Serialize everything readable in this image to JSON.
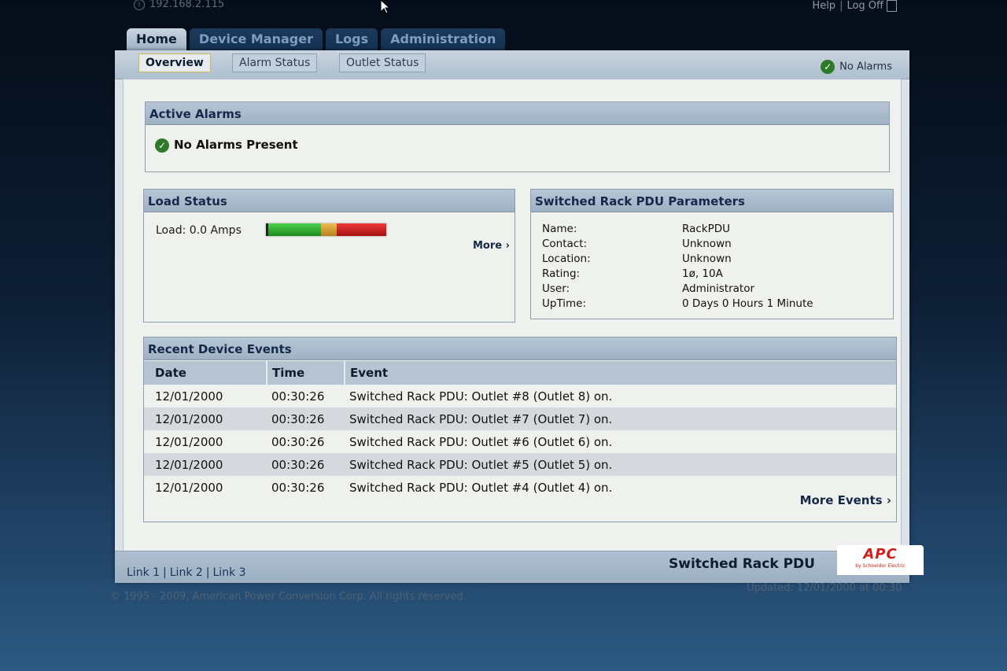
{
  "topbar": {
    "ip": "192.168.2.115",
    "help": "Help",
    "separator": "|",
    "logoff": "Log Off"
  },
  "main_tabs": [
    {
      "label": "Home",
      "active": true
    },
    {
      "label": "Device Manager",
      "active": false
    },
    {
      "label": "Logs",
      "active": false
    },
    {
      "label": "Administration",
      "active": false
    }
  ],
  "sub_tabs": [
    {
      "label": "Overview",
      "active": true
    },
    {
      "label": "Alarm Status",
      "active": false
    },
    {
      "label": "Outlet Status",
      "active": false
    }
  ],
  "status_top": "No Alarms",
  "active_alarms": {
    "title": "Active Alarms",
    "message": "No Alarms Present"
  },
  "load_status": {
    "title": "Load Status",
    "label": "Load: 0.0 Amps",
    "load_amps": 0.0,
    "more": "More"
  },
  "pdu_params": {
    "title": "Switched Rack PDU Parameters",
    "rows": [
      {
        "label": "Name:",
        "value": "RackPDU"
      },
      {
        "label": "Contact:",
        "value": "Unknown"
      },
      {
        "label": "Location:",
        "value": "Unknown"
      },
      {
        "label": "Rating:",
        "value": "1ø, 10A"
      },
      {
        "label": "User:",
        "value": "Administrator"
      },
      {
        "label": "UpTime:",
        "value": "0 Days 0 Hours 1 Minute"
      }
    ]
  },
  "recent_events": {
    "title": "Recent Device Events",
    "columns": [
      "Date",
      "Time",
      "Event"
    ],
    "rows": [
      [
        "12/01/2000",
        "00:30:26",
        "Switched Rack PDU: Outlet #8 (Outlet 8) on."
      ],
      [
        "12/01/2000",
        "00:30:26",
        "Switched Rack PDU: Outlet #7 (Outlet 7) on."
      ],
      [
        "12/01/2000",
        "00:30:26",
        "Switched Rack PDU: Outlet #6 (Outlet 6) on."
      ],
      [
        "12/01/2000",
        "00:30:26",
        "Switched Rack PDU: Outlet #5 (Outlet 5) on."
      ],
      [
        "12/01/2000",
        "00:30:26",
        "Switched Rack PDU: Outlet #4 (Outlet 4) on."
      ]
    ],
    "more": "More Events"
  },
  "footer": {
    "links": [
      "Link 1",
      "Link 2",
      "Link 3"
    ],
    "product": "Switched Rack PDU",
    "logo_text": "APC",
    "logo_sub": "by Schneider Electric",
    "copyright": "© 1995 - 2009, American Power Conversion Corp. All rights reserved.",
    "updated": "Updated: 12/01/2000 at 00:30"
  },
  "colors": {
    "ok_green": "#2f7a28",
    "bar_green": "#2ea82e",
    "bar_orange": "#d49a2a",
    "bar_red": "#cc1a1a",
    "header_blue": "#9eb1c4"
  }
}
